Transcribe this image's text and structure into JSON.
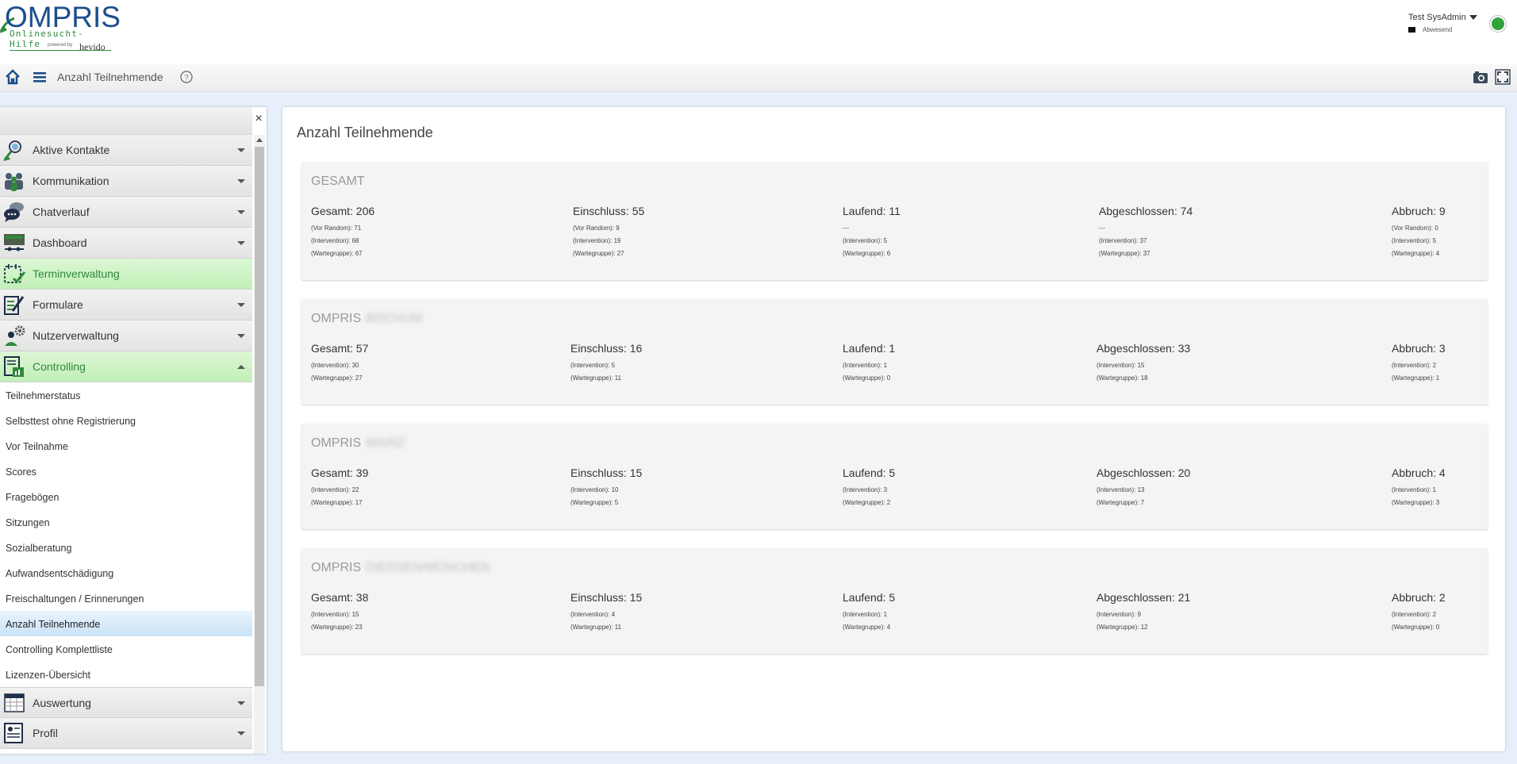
{
  "brand": {
    "logo_main": "OMPRIS",
    "logo_sub": "Onlinesucht-Hilfe",
    "powered_by": "powered by",
    "hevido": "hevido"
  },
  "user": {
    "name": "Test SysAdmin",
    "status": "Abwesend",
    "status_color": "#2fa43a"
  },
  "toolbar": {
    "title": "Anzahl Teilnehmende",
    "icons": [
      "home-icon",
      "menu-icon",
      "help-icon",
      "camera-icon",
      "fullscreen-icon"
    ]
  },
  "sidebar": {
    "close_label": "×",
    "items": [
      {
        "label": "Aktive Kontakte",
        "icon": "contacts-icon",
        "style": "normal"
      },
      {
        "label": "Kommunikation",
        "icon": "people-icon",
        "style": "normal"
      },
      {
        "label": "Chatverlauf",
        "icon": "chat-icon",
        "style": "normal"
      },
      {
        "label": "Dashboard",
        "icon": "dashboard-icon",
        "style": "normal"
      },
      {
        "label": "Terminverwaltung",
        "icon": "calendar-icon",
        "style": "green"
      },
      {
        "label": "Formulare",
        "icon": "form-icon",
        "style": "normal"
      },
      {
        "label": "Nutzerverwaltung",
        "icon": "user-gear-icon",
        "style": "normal"
      },
      {
        "label": "Controlling",
        "icon": "report-icon",
        "style": "green-open"
      }
    ],
    "controlling_sub": [
      "Teilnehmerstatus",
      "Selbsttest ohne Registrierung",
      "Vor Teilnahme",
      "Scores",
      "Fragebögen",
      "Sitzungen",
      "Sozialberatung",
      "Aufwandsentschädigung",
      "Freischaltungen / Erinnerungen",
      "Anzahl Teilnehmende",
      "Controlling Komplettliste",
      "Lizenzen-Übersicht"
    ],
    "bottom_items": [
      {
        "label": "Auswertung",
        "icon": "spreadsheet-icon"
      },
      {
        "label": "Profil",
        "icon": "profile-icon"
      }
    ]
  },
  "main": {
    "title": "Anzahl Teilnehmende",
    "cards": [
      {
        "title": "GESAMT",
        "title_blur": "",
        "columns": [
          {
            "head": "Gesamt: 206",
            "subs": [
              "(Vor Random): 71",
              "(Intervention): 68",
              "(Wartegruppe): 67"
            ]
          },
          {
            "head": "Einschluss: 55",
            "subs": [
              "(Vor Random): 9",
              "(Intervention): 19",
              "(Wartegruppe): 27"
            ]
          },
          {
            "head": "Laufend: 11",
            "subs": [
              "---",
              "(Intervention): 5",
              "(Wartegruppe): 6"
            ]
          },
          {
            "head": "Abgeschlossen: 74",
            "subs": [
              "---",
              "(Intervention): 37",
              "(Wartegruppe): 37"
            ]
          },
          {
            "head": "Abbruch: 9",
            "subs": [
              "(Vor Random): 0",
              "(Intervention): 5",
              "(Wartegruppe): 4"
            ]
          }
        ]
      },
      {
        "title": "OMPRIS",
        "title_blur": "BOCHUM",
        "columns": [
          {
            "head": "Gesamt: 57",
            "subs": [
              "(Intervention): 30",
              "(Wartegruppe): 27"
            ]
          },
          {
            "head": "Einschluss: 16",
            "subs": [
              "(Intervention): 5",
              "(Wartegruppe): 11"
            ]
          },
          {
            "head": "Laufend: 1",
            "subs": [
              "(Intervention): 1",
              "(Wartegruppe): 0"
            ]
          },
          {
            "head": "Abgeschlossen: 33",
            "subs": [
              "(Intervention): 15",
              "(Wartegruppe): 18"
            ]
          },
          {
            "head": "Abbruch: 3",
            "subs": [
              "(Intervention): 2",
              "(Wartegruppe): 1"
            ]
          }
        ]
      },
      {
        "title": "OMPRIS",
        "title_blur": "MAINZ",
        "columns": [
          {
            "head": "Gesamt: 39",
            "subs": [
              "(Intervention): 22",
              "(Wartegruppe): 17"
            ]
          },
          {
            "head": "Einschluss: 15",
            "subs": [
              "(Intervention): 10",
              "(Wartegruppe): 5"
            ]
          },
          {
            "head": "Laufend: 5",
            "subs": [
              "(Intervention): 3",
              "(Wartegruppe): 2"
            ]
          },
          {
            "head": "Abgeschlossen: 20",
            "subs": [
              "(Intervention): 13",
              "(Wartegruppe): 7"
            ]
          },
          {
            "head": "Abbruch: 4",
            "subs": [
              "(Intervention): 1",
              "(Wartegruppe): 3"
            ]
          }
        ]
      },
      {
        "title": "OMPRIS",
        "title_blur": "DIESSEN/MÜNCHEN",
        "columns": [
          {
            "head": "Gesamt: 38",
            "subs": [
              "(Intervention): 15",
              "(Wartegruppe): 23"
            ]
          },
          {
            "head": "Einschluss: 15",
            "subs": [
              "(Intervention): 4",
              "(Wartegruppe): 11"
            ]
          },
          {
            "head": "Laufend: 5",
            "subs": [
              "(Intervention): 1",
              "(Wartegruppe): 4"
            ]
          },
          {
            "head": "Abgeschlossen: 21",
            "subs": [
              "(Intervention): 9",
              "(Wartegruppe): 12"
            ]
          },
          {
            "head": "Abbruch: 2",
            "subs": [
              "(Intervention): 2",
              "(Wartegruppe): 0"
            ]
          }
        ]
      }
    ]
  }
}
